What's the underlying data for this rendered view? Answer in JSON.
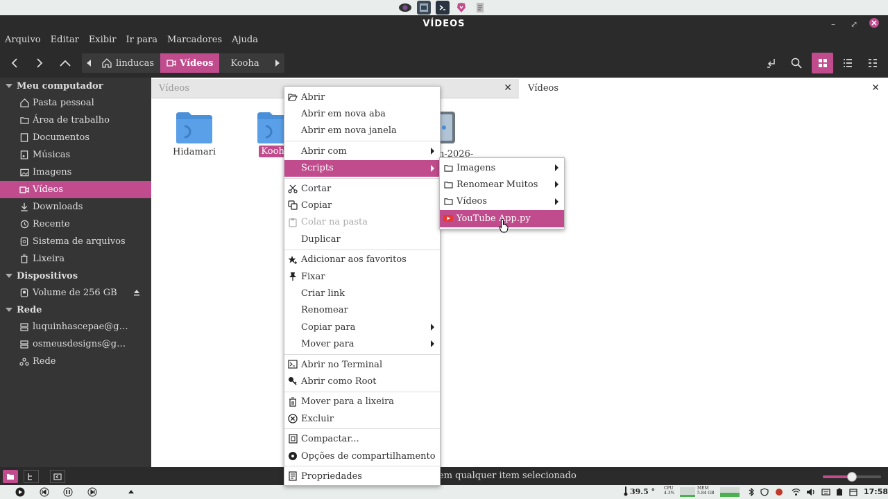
{
  "window": {
    "title": "VÍDEOS"
  },
  "menubar": {
    "items": [
      "Arquivo",
      "Editar",
      "Exibir",
      "Ir para",
      "Marcadores",
      "Ajuda"
    ]
  },
  "pathbar": {
    "items": [
      "linducas",
      "Vídeos",
      "Kooha"
    ]
  },
  "sidebar": {
    "sections": [
      {
        "title": "Meu computador",
        "items": [
          "Pasta pessoal",
          "Área de trabalho",
          "Documentos",
          "Músicas",
          "Imagens",
          "Vídeos",
          "Downloads",
          "Recente",
          "Sistema de arquivos",
          "Lixeira"
        ]
      },
      {
        "title": "Dispositivos",
        "items": [
          "Volume de 256 GB"
        ]
      },
      {
        "title": "Rede",
        "items": [
          "luquinhascepae@g…",
          "osmeusdesigns@g…",
          "Rede"
        ]
      }
    ]
  },
  "tabs": [
    {
      "label": "Vídeos"
    },
    {
      "label": "Vídeos"
    }
  ],
  "files": [
    {
      "name": "Hidamari"
    },
    {
      "name": "Kooha"
    },
    {
      "name": "n-2026-"
    }
  ],
  "context_menu": {
    "groups": [
      [
        "Abrir",
        "Abrir em nova aba",
        "Abrir em nova janela"
      ],
      [
        "Abrir com",
        "Scripts"
      ],
      [
        "Cortar",
        "Copiar",
        "Colar na pasta",
        "Duplicar"
      ],
      [
        "Adicionar aos favoritos",
        "Fixar",
        "Criar link",
        "Renomear",
        "Copiar para",
        "Mover para"
      ],
      [
        "Abrir no Terminal",
        "Abrir como Root"
      ],
      [
        "Mover para a lixeira",
        "Excluir"
      ],
      [
        "Compactar...",
        "Opções de compartilhamento"
      ],
      [
        "Propriedades"
      ]
    ]
  },
  "scripts_menu": {
    "items": [
      "Imagens",
      "Renomear Muitos",
      "Vídeos",
      "YouTube App.py"
    ]
  },
  "statusbar": {
    "text": "em qualquer item selecionado"
  },
  "taskbar": {
    "temp": "39.5 °",
    "cpu_label": "CPU",
    "cpu_value": "4.3%",
    "mem_label": "MEM",
    "mem_value": "5.84 GB",
    "clock": "17:58"
  },
  "colors": {
    "accent": "#c04c8e",
    "folder": "#4a90d9"
  }
}
